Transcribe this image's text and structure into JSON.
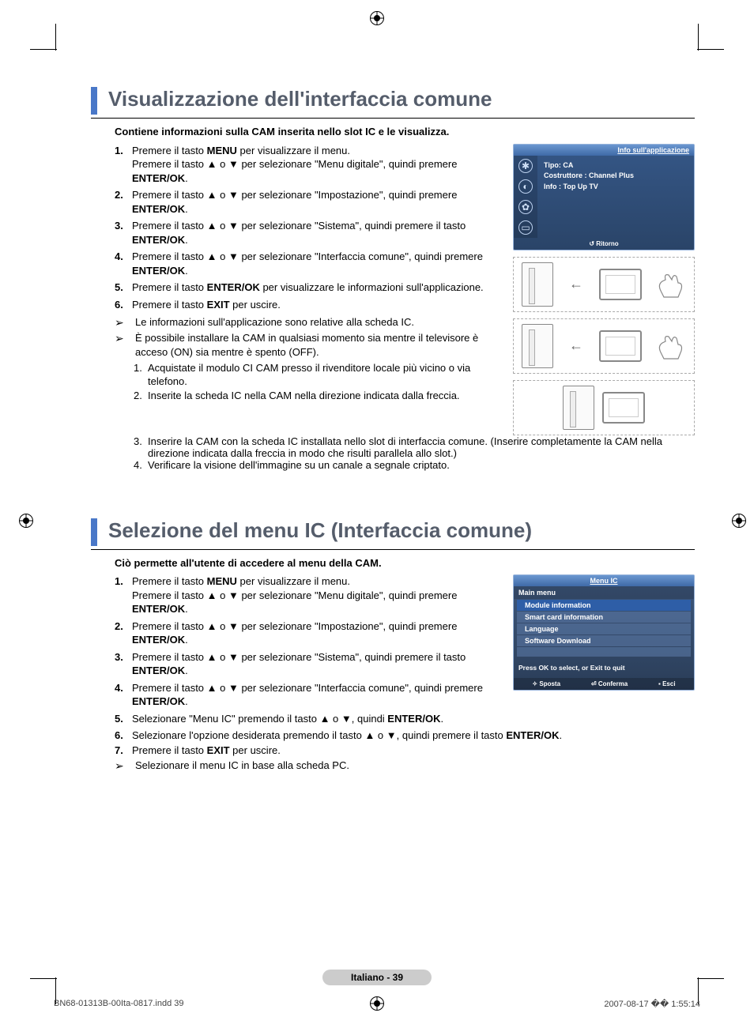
{
  "section1": {
    "title": "Visualizzazione dell'interfaccia comune",
    "intro": "Contiene informazioni sulla CAM inserita nello slot IC e le visualizza.",
    "steps": [
      {
        "pre": "Premere il tasto ",
        "b1": "MENU",
        "post": " per visualizzare il menu.\nPremere il tasto ▲ o ▼ per selezionare \"Menu digitale\", quindi premere ",
        "b2": "ENTER/OK",
        "post2": "."
      },
      {
        "pre": "Premere il tasto ▲ o ▼ per selezionare \"Impostazione\", quindi premere ",
        "b1": "ENTER/OK",
        "post": "."
      },
      {
        "pre": "Premere il tasto ▲ o ▼ per selezionare \"Sistema\", quindi premere il tasto ",
        "b1": "ENTER/OK",
        "post": "."
      },
      {
        "pre": "Premere il tasto ▲ o ▼ per selezionare \"Interfaccia comune\", quindi premere ",
        "b1": "ENTER/OK",
        "post": "."
      },
      {
        "pre": "Premere il tasto ",
        "b1": "ENTER/OK",
        "post": " per visualizzare le informazioni sull'applicazione."
      },
      {
        "pre": "Premere il tasto ",
        "b1": "EXIT",
        "post": " per uscire."
      }
    ],
    "note1": "Le informazioni sull'applicazione sono relative alla scheda IC.",
    "note2": "È possibile installare la CAM in qualsiasi momento sia mentre il televisore è acceso (ON) sia mentre è spento (OFF).",
    "subs": [
      "Acquistate il modulo CI CAM presso il rivenditore locale più vicino o via telefono.",
      "Inserite la scheda IC nella CAM nella direzione indicata dalla freccia.",
      "Inserire la CAM con la scheda IC installata nello slot di interfaccia comune. (Inserire completamente la CAM nella direzione indicata dalla freccia in modo che risulti parallela allo slot.)",
      "Verificare la visione dell'immagine su un canale a segnale criptato."
    ]
  },
  "tvMenu1": {
    "title": "Info sull'applicazione",
    "line1": "Tipo: CA",
    "line2": "Costruttore : Channel Plus",
    "line3": "Info : Top Up TV",
    "return": "Ritorno"
  },
  "section2": {
    "title": "Selezione del menu IC (Interfaccia comune)",
    "intro": "Ciò permette all'utente di accedere al menu della CAM.",
    "steps": [
      {
        "pre": "Premere il tasto ",
        "b1": "MENU",
        "post": " per visualizzare il menu.\nPremere il tasto ▲ o ▼ per selezionare \"Menu digitale\", quindi premere ",
        "b2": "ENTER/OK",
        "post2": "."
      },
      {
        "pre": "Premere il tasto ▲ o ▼ per selezionare \"Impostazione\", quindi premere ",
        "b1": "ENTER/OK",
        "post": "."
      },
      {
        "pre": "Premere il tasto ▲ o ▼ per selezionare \"Sistema\", quindi premere il tasto ",
        "b1": "ENTER/OK",
        "post": "."
      },
      {
        "pre": "Premere il tasto ▲ o ▼ per selezionare \"Interfaccia comune\", quindi premere ",
        "b1": "ENTER/OK",
        "post": "."
      },
      {
        "pre": "Selezionare \"Menu IC\" premendo il tasto ▲ o ▼, quindi ",
        "b1": "ENTER/OK",
        "post": "."
      },
      {
        "pre": "Selezionare l'opzione desiderata premendo il tasto ▲ o ▼, quindi premere il tasto ",
        "b1": "ENTER/OK",
        "post": "."
      },
      {
        "pre": "Premere il tasto ",
        "b1": "EXIT",
        "post": " per uscire."
      }
    ],
    "note1": "Selezionare il menu IC in base alla scheda PC."
  },
  "tvMenu2": {
    "title": "Menu IC",
    "main": "Main menu",
    "rows": [
      "Module information",
      "Smart card information",
      "Language",
      "Software Download"
    ],
    "msg": "Press OK to select, or Exit to quit",
    "foot": [
      "Sposta",
      "Conferma",
      "Esci"
    ]
  },
  "pageLang": "Italiano - 39",
  "footer": {
    "left": "BN68-01313B-00Ita-0817.indd   39",
    "right": "2007-08-17   �� 1:55:14"
  }
}
